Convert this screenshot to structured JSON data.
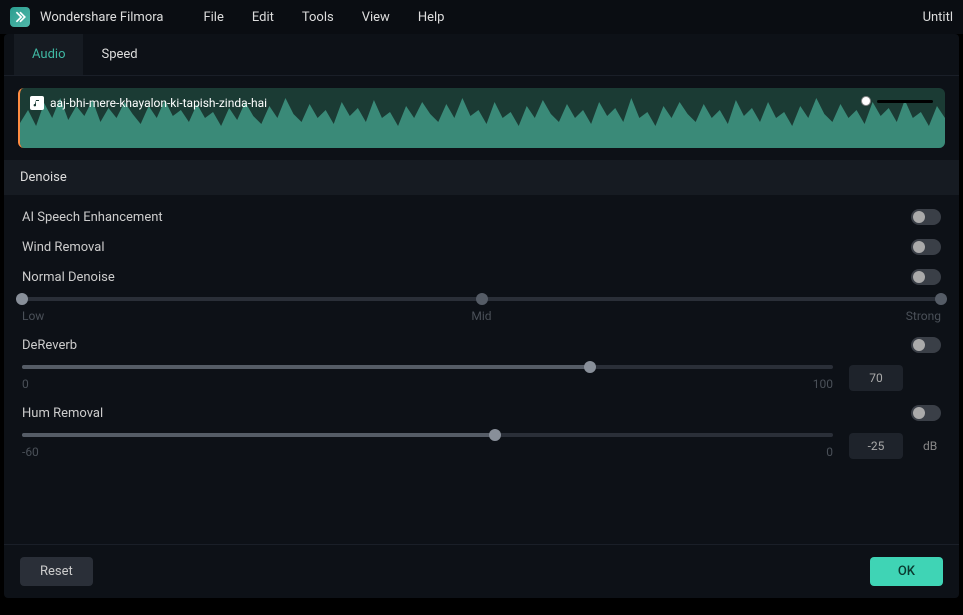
{
  "app": {
    "name": "Wondershare Filmora",
    "doc_title": "Untitl"
  },
  "menu": [
    "File",
    "Edit",
    "Tools",
    "View",
    "Help"
  ],
  "tabs": [
    {
      "label": "Audio",
      "active": true
    },
    {
      "label": "Speed",
      "active": false
    }
  ],
  "clip": {
    "name": "aaj-bhi-mere-khayalon-ki-tapish-zinda-hai"
  },
  "section": {
    "title": "Denoise"
  },
  "denoise": {
    "ai_speech": {
      "label": "AI Speech Enhancement",
      "enabled": false
    },
    "wind": {
      "label": "Wind Removal",
      "enabled": false
    },
    "normal": {
      "label": "Normal Denoise",
      "enabled": false,
      "value": 0,
      "labels": {
        "low": "Low",
        "mid": "Mid",
        "high": "Strong"
      }
    },
    "dereverb": {
      "label": "DeReverb",
      "enabled": false,
      "value": 70,
      "min": "0",
      "max": "100"
    },
    "hum": {
      "label": "Hum Removal",
      "enabled": false,
      "value": -25,
      "unit": "dB",
      "min": "-60",
      "max": "0"
    }
  },
  "footer": {
    "reset": "Reset",
    "ok": "OK"
  }
}
